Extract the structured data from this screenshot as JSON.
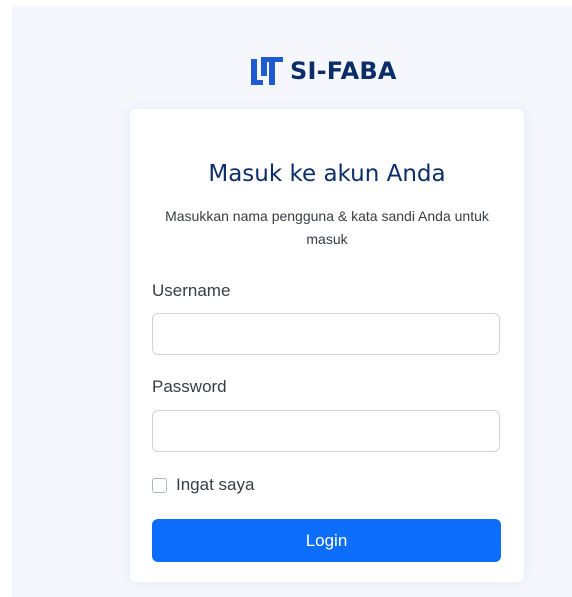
{
  "brand": {
    "name": "SI-FABA",
    "logo_icon": "brand-logo-icon",
    "color": "#0b2e69"
  },
  "login_card": {
    "title": "Masuk ke akun Anda",
    "subtitle": "Masukkan nama pengguna & kata sandi Anda untuk masuk",
    "username": {
      "label": "Username",
      "value": "",
      "placeholder": ""
    },
    "password": {
      "label": "Password",
      "value": "",
      "placeholder": ""
    },
    "remember_me": {
      "label": "Ingat saya",
      "checked": false
    },
    "login_button": {
      "label": "Login",
      "color": "#0d6efd"
    }
  }
}
